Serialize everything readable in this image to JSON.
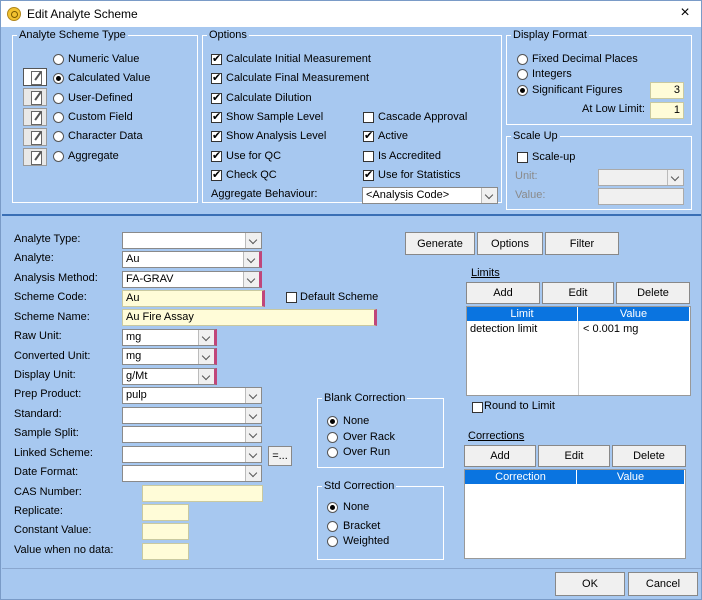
{
  "window": {
    "title": "Edit Analyte Scheme",
    "close_icon": "×"
  },
  "scheme_type": {
    "legend": "Analyte Scheme Type",
    "options": [
      {
        "label": "Numeric Value",
        "checked": false
      },
      {
        "label": "Calculated Value",
        "checked": true
      },
      {
        "label": "User-Defined",
        "checked": false
      },
      {
        "label": "Custom Field",
        "checked": false
      },
      {
        "label": "Character Data",
        "checked": false
      },
      {
        "label": "Aggregate",
        "checked": false
      }
    ]
  },
  "options": {
    "legend": "Options",
    "left": [
      {
        "label": "Calculate Initial Measurement",
        "checked": true
      },
      {
        "label": "Calculate Final Measurement",
        "checked": true
      },
      {
        "label": "Calculate Dilution",
        "checked": true
      },
      {
        "label": "Show Sample Level",
        "checked": true
      },
      {
        "label": "Show Analysis Level",
        "checked": true
      },
      {
        "label": "Use for QC",
        "checked": true
      },
      {
        "label": "Check QC",
        "checked": true
      }
    ],
    "right": [
      {
        "label": "Cascade Approval",
        "checked": false
      },
      {
        "label": "Active",
        "checked": true
      },
      {
        "label": "Is Accredited",
        "checked": false
      },
      {
        "label": "Use for Statistics",
        "checked": true
      }
    ],
    "aggregate_label": "Aggregate Behaviour:",
    "aggregate_value": "<Analysis Code>"
  },
  "display_format": {
    "legend": "Display Format",
    "options": [
      {
        "label": "Fixed Decimal Places",
        "checked": false
      },
      {
        "label": "Integers",
        "checked": false
      },
      {
        "label": "Significant Figures",
        "checked": true
      }
    ],
    "sig_figs_value": "3",
    "low_limit_label": "At Low Limit:",
    "low_limit_value": "1"
  },
  "scale_up": {
    "legend": "Scale Up",
    "checkbox_label": "Scale-up",
    "unit_label": "Unit:",
    "value_label": "Value:"
  },
  "form": {
    "labels": {
      "analyte_type": "Analyte Type:",
      "analyte": "Analyte:",
      "analysis_method": "Analysis Method:",
      "scheme_code": "Scheme Code:",
      "scheme_name": "Scheme Name:",
      "raw_unit": "Raw Unit:",
      "converted_unit": "Converted Unit:",
      "display_unit": "Display Unit:",
      "prep_product": "Prep Product:",
      "standard": "Standard:",
      "sample_split": "Sample Split:",
      "linked_scheme": "Linked Scheme:",
      "date_format": "Date Format:",
      "cas_number": "CAS Number:",
      "replicate": "Replicate:",
      "constant_value": "Constant Value:",
      "value_when_no_data": "Value when no data:"
    },
    "values": {
      "analyte_type": "",
      "analyte": "Au",
      "analysis_method": "FA-GRAV",
      "scheme_code": "Au",
      "scheme_name": "Au Fire Assay",
      "raw_unit": "mg",
      "converted_unit": "mg",
      "display_unit": "g/Mt",
      "prep_product": "pulp",
      "standard": "",
      "sample_split": "",
      "linked_scheme": "",
      "date_format": "",
      "cas_number": "",
      "replicate": "",
      "constant_value": "",
      "value_when_no_data": ""
    },
    "default_scheme_label": "Default Scheme",
    "linked_scheme_button": "=..."
  },
  "blank_correction": {
    "legend": "Blank Correction",
    "options": [
      {
        "label": "None",
        "checked": true
      },
      {
        "label": "Over Rack",
        "checked": false
      },
      {
        "label": "Over Run",
        "checked": false
      }
    ]
  },
  "std_correction": {
    "legend": "Std Correction",
    "options": [
      {
        "label": "None",
        "checked": true
      },
      {
        "label": "Bracket",
        "checked": false
      },
      {
        "label": "Weighted",
        "checked": false
      }
    ]
  },
  "toolbar": {
    "generate": "Generate",
    "options": "Options",
    "filter": "Filter"
  },
  "limits": {
    "title": "Limits",
    "add": "Add",
    "edit": "Edit",
    "delete": "Delete",
    "columns": [
      "Limit",
      "Value"
    ],
    "rows": [
      {
        "limit": "detection limit",
        "value": "< 0.001 mg"
      }
    ],
    "round_label": "Round to Limit"
  },
  "corrections": {
    "title": "Corrections",
    "add": "Add",
    "edit": "Edit",
    "delete": "Delete",
    "columns": [
      "Correction",
      "Value"
    ]
  },
  "footer": {
    "ok": "OK",
    "cancel": "Cancel"
  }
}
